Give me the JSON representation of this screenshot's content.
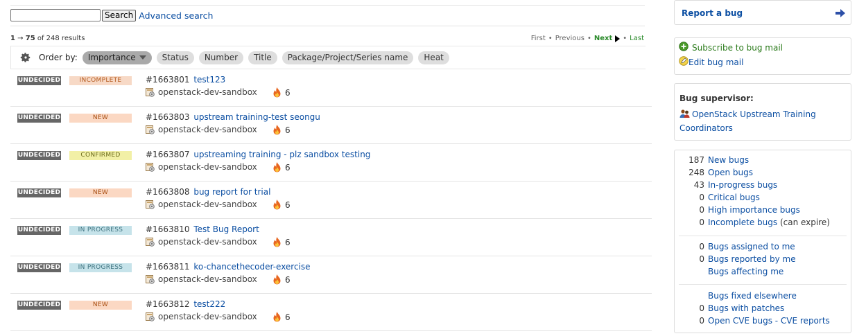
{
  "search": {
    "value": "",
    "button": "Search",
    "advanced": "Advanced search"
  },
  "results": {
    "range_start": "1",
    "arrow": "→",
    "range_end": "75",
    "of_text": "of 248 results"
  },
  "pager": {
    "first": "First",
    "previous": "Previous",
    "next": "Next",
    "last": "Last",
    "dot": "•"
  },
  "orderbar": {
    "label": "Order by:",
    "options": [
      "Importance",
      "Status",
      "Number",
      "Title",
      "Package/Project/Series name",
      "Heat"
    ],
    "active": "Importance"
  },
  "colors": {
    "link": "#0b4ea2",
    "incomplete_bg": "#f7d9c6",
    "incomplete_fg": "#b45a1e",
    "new_bg": "#fbd8c3",
    "new_fg": "#a84e12",
    "confirmed_bg": "#f2f0a6",
    "confirmed_fg": "#6b6a1a",
    "inprogress_bg": "#c6e3ea",
    "inprogress_fg": "#3a6f7c",
    "undecided_bg": "#666666"
  },
  "bugs": [
    {
      "importance": "UNDECIDED",
      "status": "INCOMPLETE",
      "status_key": "incomplete",
      "number": "#1663801",
      "title": "test123",
      "project": "openstack-dev-sandbox",
      "heat": "6"
    },
    {
      "importance": "UNDECIDED",
      "status": "NEW",
      "status_key": "new",
      "number": "#1663803",
      "title": "upstream training-test seongu",
      "project": "openstack-dev-sandbox",
      "heat": "6"
    },
    {
      "importance": "UNDECIDED",
      "status": "CONFIRMED",
      "status_key": "confirmed",
      "number": "#1663807",
      "title": "upstreaming training - plz sandbox testing",
      "project": "openstack-dev-sandbox",
      "heat": "6"
    },
    {
      "importance": "UNDECIDED",
      "status": "NEW",
      "status_key": "new",
      "number": "#1663808",
      "title": "bug report for trial",
      "project": "openstack-dev-sandbox",
      "heat": "6"
    },
    {
      "importance": "UNDECIDED",
      "status": "IN PROGRESS",
      "status_key": "inprogress",
      "number": "#1663810",
      "title": "Test Bug Report",
      "project": "openstack-dev-sandbox",
      "heat": "6"
    },
    {
      "importance": "UNDECIDED",
      "status": "IN PROGRESS",
      "status_key": "inprogress",
      "number": "#1663811",
      "title": "ko-chancethecoder-exercise",
      "project": "openstack-dev-sandbox",
      "heat": "6"
    },
    {
      "importance": "UNDECIDED",
      "status": "NEW",
      "status_key": "new",
      "number": "#1663812",
      "title": "test222",
      "project": "openstack-dev-sandbox",
      "heat": "6"
    }
  ],
  "sidebar": {
    "report_bug": "Report a bug",
    "subscribe": "Subscribe to bug mail",
    "edit_mail": "Edit bug mail",
    "supervisor_heading": "Bug supervisor:",
    "supervisor_name": "OpenStack Upstream Training Coordinators",
    "stats_group1": [
      {
        "count": "187",
        "label": "New bugs",
        "extra": ""
      },
      {
        "count": "248",
        "label": "Open bugs",
        "extra": ""
      },
      {
        "count": "43",
        "label": "In-progress bugs",
        "extra": ""
      },
      {
        "count": "0",
        "label": "Critical bugs",
        "extra": ""
      },
      {
        "count": "0",
        "label": "High importance bugs",
        "extra": ""
      },
      {
        "count": "0",
        "label": "Incomplete bugs",
        "extra": "(can expire)"
      }
    ],
    "stats_group2": [
      {
        "count": "0",
        "label": "Bugs assigned to me",
        "extra": ""
      },
      {
        "count": "0",
        "label": "Bugs reported by me",
        "extra": ""
      },
      {
        "count": "",
        "label": "Bugs affecting me",
        "extra": ""
      }
    ],
    "stats_group3": [
      {
        "count": "",
        "label": "Bugs fixed elsewhere",
        "extra": ""
      },
      {
        "count": "0",
        "label": "Bugs with patches",
        "extra": ""
      },
      {
        "count": "0",
        "label": "Open CVE bugs - CVE reports",
        "extra": ""
      }
    ]
  },
  "icons": {
    "gear": "gear-icon",
    "heat": "flame-icon",
    "project": "project-icon",
    "arrow": "arrow-right-icon",
    "subscribe": "plus-circle-icon",
    "edit": "pencil-icon",
    "team": "team-icon"
  }
}
